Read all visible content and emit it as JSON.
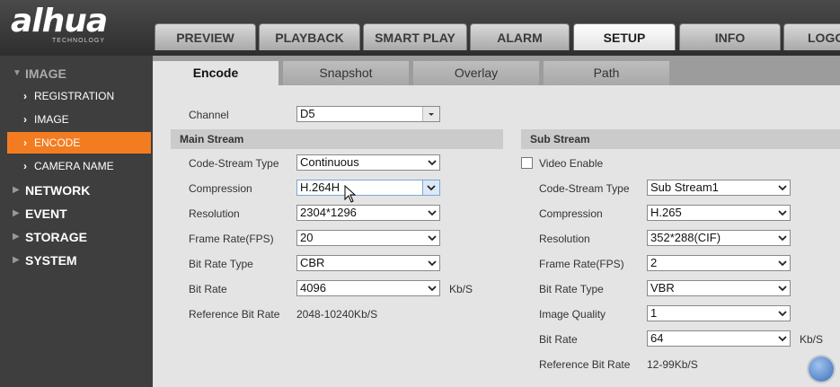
{
  "header": {
    "brand": "alhua",
    "brand_sub": "TECHNOLOGY",
    "tabs": [
      {
        "label": "PREVIEW"
      },
      {
        "label": "PLAYBACK"
      },
      {
        "label": "SMART PLAY"
      },
      {
        "label": "ALARM"
      },
      {
        "label": "SETUP"
      },
      {
        "label": "INFO"
      },
      {
        "label": "LOGO"
      }
    ]
  },
  "sidebar": {
    "image_group": "IMAGE",
    "sub_items": [
      {
        "label": "REGISTRATION"
      },
      {
        "label": "IMAGE"
      },
      {
        "label": "ENCODE"
      },
      {
        "label": "CAMERA NAME"
      }
    ],
    "groups": [
      {
        "label": "NETWORK"
      },
      {
        "label": "EVENT"
      },
      {
        "label": "STORAGE"
      },
      {
        "label": "SYSTEM"
      }
    ]
  },
  "tabs": [
    {
      "label": "Encode"
    },
    {
      "label": "Snapshot"
    },
    {
      "label": "Overlay"
    },
    {
      "label": "Path"
    }
  ],
  "channel": {
    "label": "Channel",
    "value": "D5"
  },
  "main_stream": {
    "title": "Main Stream",
    "code_stream_type": {
      "label": "Code-Stream Type",
      "value": "Continuous"
    },
    "compression": {
      "label": "Compression",
      "value": "H.264H"
    },
    "resolution": {
      "label": "Resolution",
      "value": "2304*1296"
    },
    "frame_rate": {
      "label": "Frame Rate(FPS)",
      "value": "20"
    },
    "bit_rate_type": {
      "label": "Bit Rate Type",
      "value": "CBR"
    },
    "bit_rate": {
      "label": "Bit Rate",
      "value": "4096",
      "unit": "Kb/S"
    },
    "reference_bit_rate": {
      "label": "Reference Bit Rate",
      "value": "2048-10240Kb/S"
    }
  },
  "sub_stream": {
    "title": "Sub Stream",
    "video_enable": {
      "label": "Video Enable",
      "checked": false
    },
    "code_stream_type": {
      "label": "Code-Stream Type",
      "value": "Sub Stream1"
    },
    "compression": {
      "label": "Compression",
      "value": "H.265"
    },
    "resolution": {
      "label": "Resolution",
      "value": "352*288(CIF)"
    },
    "frame_rate": {
      "label": "Frame Rate(FPS)",
      "value": "2"
    },
    "bit_rate_type": {
      "label": "Bit Rate Type",
      "value": "VBR"
    },
    "image_quality": {
      "label": "Image Quality",
      "value": "1"
    },
    "bit_rate": {
      "label": "Bit Rate",
      "value": "64",
      "unit": "Kb/S"
    },
    "reference_bit_rate": {
      "label": "Reference Bit Rate",
      "value": "12-99Kb/S"
    }
  },
  "colors": {
    "accent": "#f47c20",
    "sidebar_bg": "#3e3e3e",
    "header_bg": "#2e2e2e"
  }
}
